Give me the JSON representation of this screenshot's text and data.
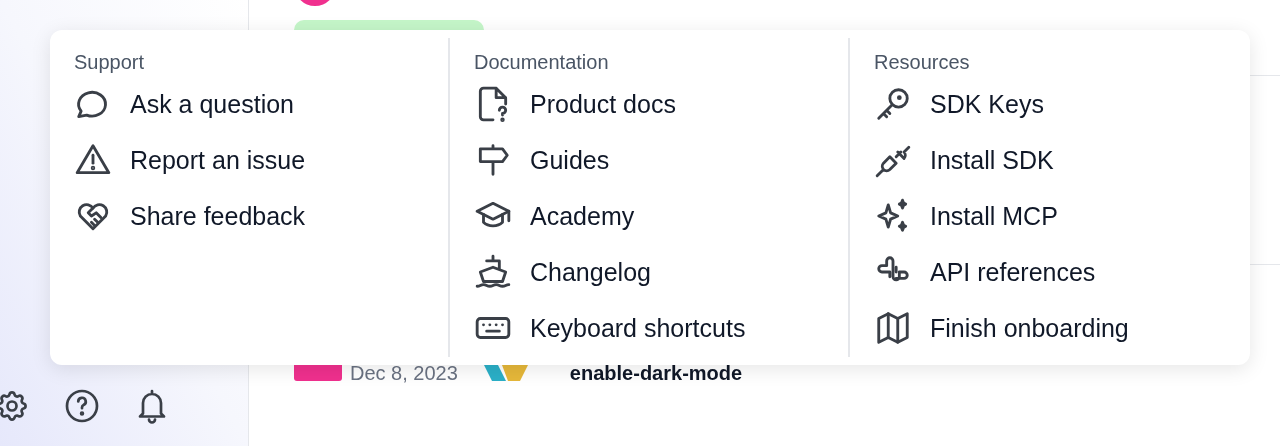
{
  "help_menu": {
    "sections": [
      {
        "title": "Support",
        "items": [
          {
            "label": "Ask a question"
          },
          {
            "label": "Report an issue"
          },
          {
            "label": "Share feedback"
          }
        ]
      },
      {
        "title": "Documentation",
        "items": [
          {
            "label": "Product docs"
          },
          {
            "label": "Guides"
          },
          {
            "label": "Academy"
          },
          {
            "label": "Changelog"
          },
          {
            "label": "Keyboard shortcuts"
          }
        ]
      },
      {
        "title": "Resources",
        "items": [
          {
            "label": "SDK Keys"
          },
          {
            "label": "Install SDK"
          },
          {
            "label": "Install MCP"
          },
          {
            "label": "API references"
          },
          {
            "label": "Finish onboarding"
          }
        ]
      }
    ]
  },
  "background_row": {
    "date": "Dec 8, 2023",
    "flag_name": "enable-dark-mode"
  }
}
